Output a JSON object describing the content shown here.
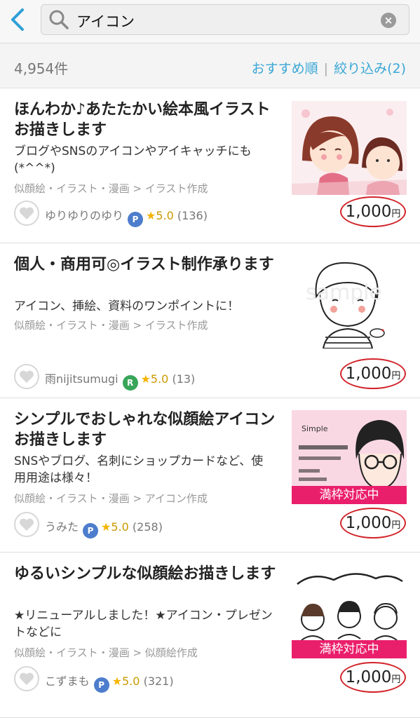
{
  "header": {
    "search_query": "アイコン",
    "clear_label": "×"
  },
  "results": {
    "count": "4,954件",
    "sort_label": "おすすめ順",
    "filter_label": "絞り込み(2)"
  },
  "items": [
    {
      "title": "ほんわか♪あたたかい絵本風イラストお描きします",
      "desc": "ブログやSNSのアイコンやアイキャッチにも(*^^*)",
      "category": "似顔絵・イラスト・漫画 > イラスト作成",
      "seller": "ゆりゆりのゆり",
      "rating": "5.0",
      "reviews": "(136)",
      "price": "1,000",
      "yen": "円",
      "banner": ""
    },
    {
      "title": "個人・商用可◎イラスト制作承ります",
      "desc": "アイコン、挿絵、資料のワンポイントに！",
      "category": "似顔絵・イラスト・漫画 > イラスト作成",
      "seller": "雨nijitsumugi",
      "rating": "5.0",
      "reviews": "(13)",
      "price": "1,000",
      "yen": "円",
      "banner": ""
    },
    {
      "title": "シンプルでおしゃれな似顔絵アイコンお描きします",
      "desc": "SNSやブログ、名刺にショップカードなど、使用用途は様々！",
      "category": "似顔絵・イラスト・漫画 > アイコン作成",
      "seller": "うみた",
      "rating": "5.0",
      "reviews": "(258)",
      "price": "1,000",
      "yen": "円",
      "banner": "満枠対応中"
    },
    {
      "title": "ゆるいシンプルな似顔絵お描きします",
      "desc": "★リニューアルしました！★アイコン・プレゼントなどに",
      "category": "似顔絵・イラスト・漫画 > 似顔絵作成",
      "seller": "こずまも",
      "rating": "5.0",
      "reviews": "(321)",
      "price": "1,000",
      "yen": "円",
      "banner": "満枠対応中"
    }
  ],
  "colors": {
    "accent": "#3aa7d6",
    "price_circle": "#d2242a",
    "banner": "#ea1f6c",
    "star": "#f5b400"
  }
}
